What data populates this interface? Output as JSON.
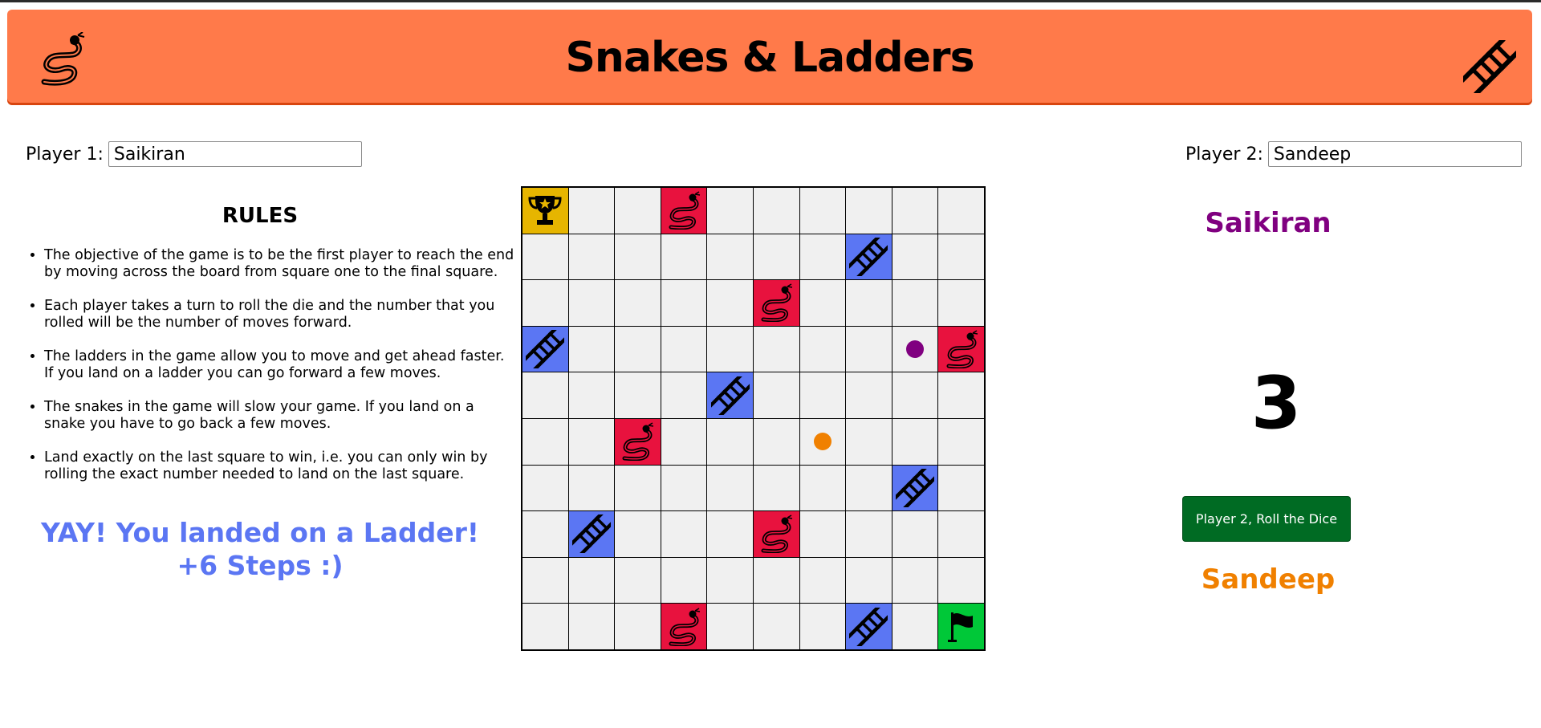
{
  "header": {
    "title": "Snakes & Ladders"
  },
  "players": {
    "p1": {
      "label": "Player 1:",
      "name": "Saikiran",
      "color": "#800080"
    },
    "p2": {
      "label": "Player 2:",
      "name": "Sandeep",
      "color": "#f08000"
    }
  },
  "rules": {
    "title": "RULES",
    "items": [
      "The objective of the game is to be the first player to reach the end by moving across the board from square one to the final square.",
      "Each player takes a turn to roll the die and the number that you rolled will be the number of moves forward.",
      "The ladders in the game allow you to move and get ahead faster. If you land on a ladder you can go forward a few moves.",
      "The snakes in the game will slow your game. If you land on a snake you have to go back a few moves.",
      "Land exactly on the last square to win, i.e. you can only win by rolling the exact number needed to land on the last square."
    ]
  },
  "message": {
    "line1": "YAY! You landed on a Ladder!",
    "line2": "+6 Steps :)"
  },
  "status": {
    "current_name": "Saikiran",
    "dice_value": "3",
    "roll_button": "Player 2, Roll the Dice",
    "next_name": "Sandeep"
  },
  "board": {
    "rows": 10,
    "cols": 10,
    "colors": {
      "snake": "#e8123e",
      "ladder": "#5b76f3",
      "trophy": "#e6b500",
      "flag": "#00c838",
      "empty": "#f0f0f0"
    },
    "special": [
      {
        "row": 0,
        "col": 0,
        "type": "trophy",
        "icon": "trophy-icon"
      },
      {
        "row": 0,
        "col": 3,
        "type": "snake",
        "icon": "snake-icon"
      },
      {
        "row": 1,
        "col": 7,
        "type": "ladder",
        "icon": "ladder-icon"
      },
      {
        "row": 2,
        "col": 5,
        "type": "snake",
        "icon": "snake-icon"
      },
      {
        "row": 3,
        "col": 0,
        "type": "ladder",
        "icon": "ladder-icon"
      },
      {
        "row": 3,
        "col": 9,
        "type": "snake",
        "icon": "snake-icon"
      },
      {
        "row": 4,
        "col": 4,
        "type": "ladder",
        "icon": "ladder-icon"
      },
      {
        "row": 5,
        "col": 2,
        "type": "snake",
        "icon": "snake-icon"
      },
      {
        "row": 6,
        "col": 8,
        "type": "ladder",
        "icon": "ladder-icon"
      },
      {
        "row": 7,
        "col": 1,
        "type": "ladder",
        "icon": "ladder-icon"
      },
      {
        "row": 7,
        "col": 5,
        "type": "snake",
        "icon": "snake-icon"
      },
      {
        "row": 9,
        "col": 3,
        "type": "snake",
        "icon": "snake-icon"
      },
      {
        "row": 9,
        "col": 7,
        "type": "ladder",
        "icon": "ladder-icon"
      },
      {
        "row": 9,
        "col": 9,
        "type": "flag",
        "icon": "flag-icon"
      }
    ],
    "tokens": [
      {
        "player": "p1",
        "row": 3,
        "col": 8
      },
      {
        "player": "p2",
        "row": 5,
        "col": 6
      }
    ]
  }
}
